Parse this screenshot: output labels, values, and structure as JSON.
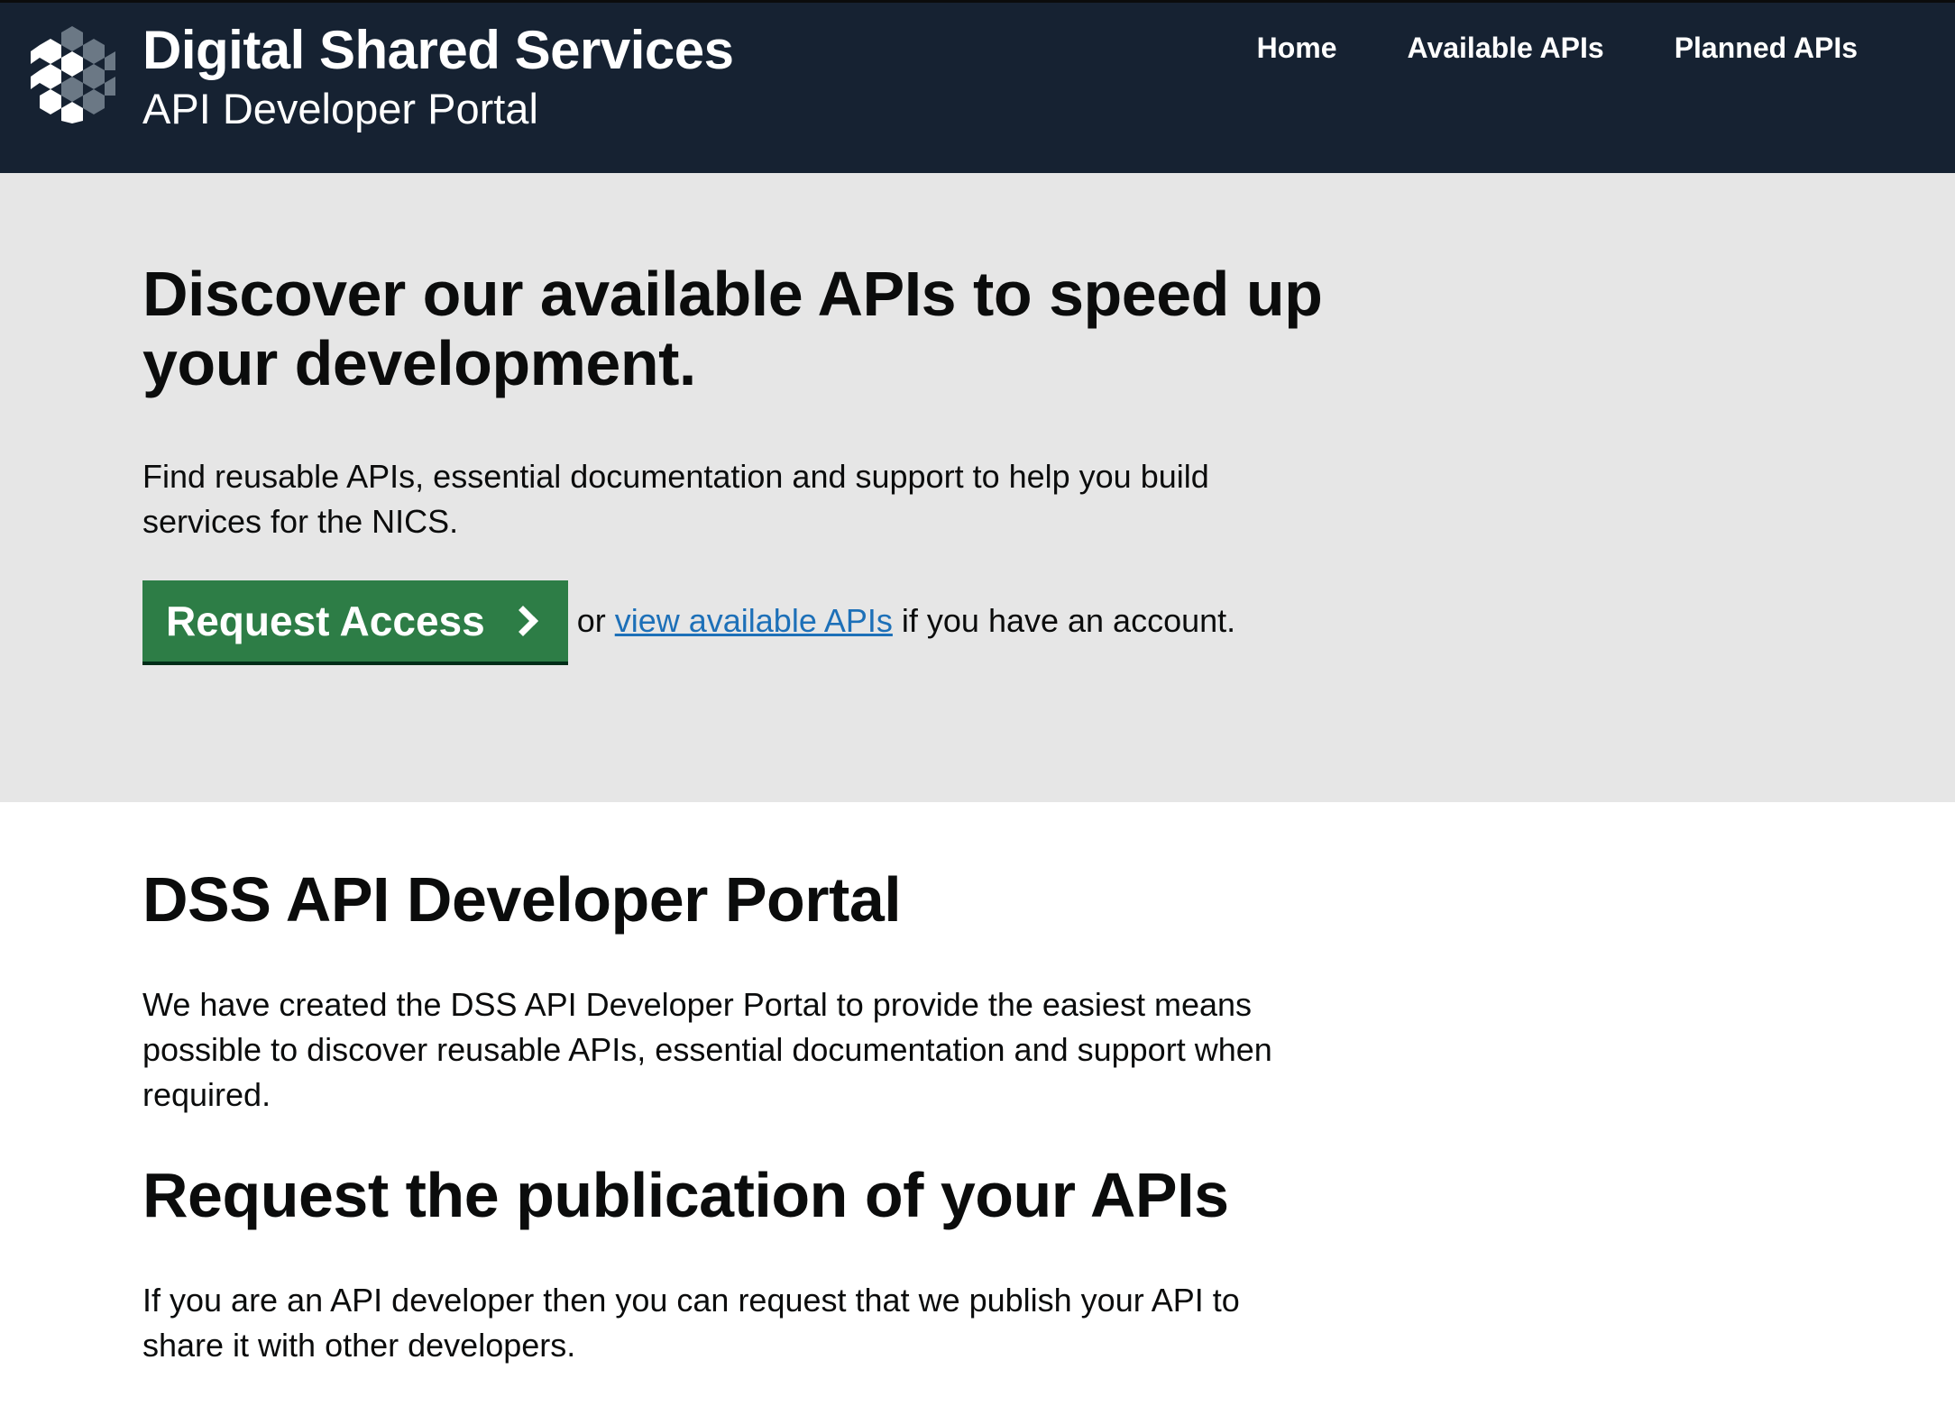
{
  "header": {
    "brand_title": "Digital Shared Services",
    "brand_subtitle": "API Developer Portal",
    "nav": [
      {
        "label": "Home"
      },
      {
        "label": "Available APIs"
      },
      {
        "label": "Planned APIs"
      }
    ]
  },
  "hero": {
    "heading": "Discover our available APIs to speed up your development.",
    "text": "Find reusable APIs, essential documentation and support to help you build services for the NICS.",
    "button_label": "Request Access",
    "or_text": "or ",
    "link_text": "view available APIs",
    "after_link_text": " if you have an account."
  },
  "main": {
    "portal_heading": "DSS API Developer Portal",
    "portal_text": "We have created the DSS API Developer Portal to provide the easiest means possible to discover reusable APIs, essential documentation and support when required.",
    "publish_heading": "Request the publication of your APIs",
    "publish_text": "If you are an API developer then you can request that we publish your API to share it with other developers."
  },
  "colors": {
    "header_bg": "#162232",
    "hero_bg": "#e6e6e6",
    "button_green": "#2d7d46",
    "link_blue": "#1d70b8"
  }
}
